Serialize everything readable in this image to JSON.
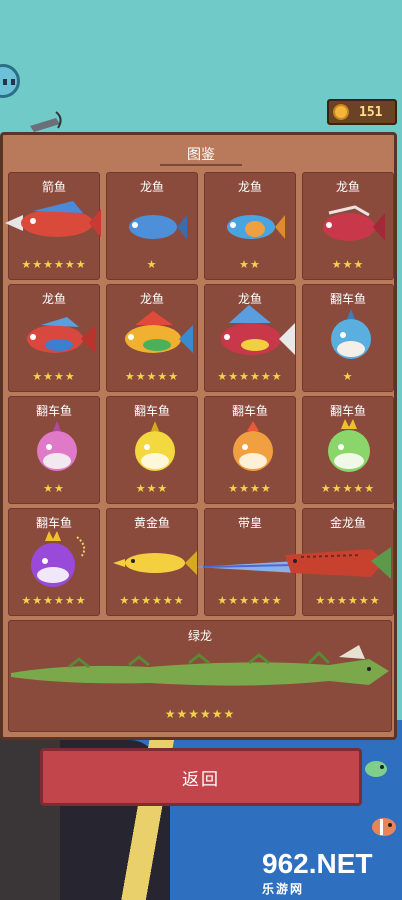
{
  "hud": {
    "coins": "151"
  },
  "panel": {
    "title": "图鉴"
  },
  "cells": [
    {
      "name": "箭鱼",
      "stars": "★★★★★★"
    },
    {
      "name": "龙鱼",
      "stars": "★"
    },
    {
      "name": "龙鱼",
      "stars": "★★"
    },
    {
      "name": "龙鱼",
      "stars": "★★★"
    },
    {
      "name": "龙鱼",
      "stars": "★★★★"
    },
    {
      "name": "龙鱼",
      "stars": "★★★★★"
    },
    {
      "name": "龙鱼",
      "stars": "★★★★★★"
    },
    {
      "name": "翻车鱼",
      "stars": "★"
    },
    {
      "name": "翻车鱼",
      "stars": "★★"
    },
    {
      "name": "翻车鱼",
      "stars": "★★★"
    },
    {
      "name": "翻车鱼",
      "stars": "★★★★"
    },
    {
      "name": "翻车鱼",
      "stars": "★★★★★"
    },
    {
      "name": "翻车鱼",
      "stars": "★★★★★★"
    },
    {
      "name": "黄金鱼",
      "stars": "★★★★★★"
    },
    {
      "name": "带皇",
      "stars": "★★★★★★"
    },
    {
      "name": "金龙鱼",
      "stars": "★★★★★★"
    }
  ],
  "wide_cell": {
    "name": "绿龙",
    "stars": "★★★★★★"
  },
  "back_button": {
    "label": "返回"
  },
  "watermark": {
    "big": "962.NET",
    "small": "乐游网"
  },
  "colors": {
    "panel": "#b87a5a",
    "cell": "#8a4a3c",
    "star": "#f2d24a",
    "button": "#c2454b"
  }
}
